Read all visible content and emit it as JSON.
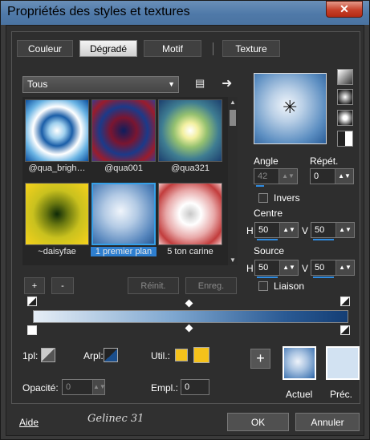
{
  "window": {
    "title": "Propriétés des styles et textures",
    "close_label": "✕"
  },
  "tabs": [
    "Couleur",
    "Dégradé",
    "Motif",
    "Texture"
  ],
  "combo": {
    "value": "Tous"
  },
  "gallery": [
    {
      "label": "@qua_brigh…"
    },
    {
      "label": "@qua001"
    },
    {
      "label": "@qua321"
    },
    {
      "label": "~daisyfae"
    },
    {
      "label": "1 premier plan"
    },
    {
      "label": "5 ton carine"
    }
  ],
  "gallery_buttons": {
    "add": "+",
    "remove": "-",
    "reset": "Réinit.",
    "save": "Enreg."
  },
  "angle": {
    "label": "Angle",
    "value": "42"
  },
  "repeat": {
    "label": "Répét.",
    "value": "0"
  },
  "invert_label": "Invers",
  "center": {
    "label": "Centre",
    "h_label": "H",
    "h_value": "50",
    "v_label": "V",
    "v_value": "50"
  },
  "source": {
    "label": "Source",
    "h_label": "H",
    "h_value": "50",
    "v_label": "V",
    "v_value": "50"
  },
  "link_label": "Liaison",
  "bottom": {
    "first_plan": "1pl:",
    "arrow_plan": "Arpl:",
    "used": "Util.:",
    "opacity_label": "Opacité:",
    "opacity_value": "0",
    "location_label": "Empl.:",
    "location_value": "0"
  },
  "current": {
    "add": "+",
    "actual": "Actuel",
    "previous": "Préc."
  },
  "footer": {
    "help": "Aide",
    "signature": "Gelinec 31",
    "ok": "OK",
    "cancel": "Annuler"
  },
  "colors": {
    "accent": "#35a0e8",
    "gradient_start": "#e6eef6",
    "gradient_end": "#143e75",
    "swatch_yellow": "#f5c21b"
  }
}
